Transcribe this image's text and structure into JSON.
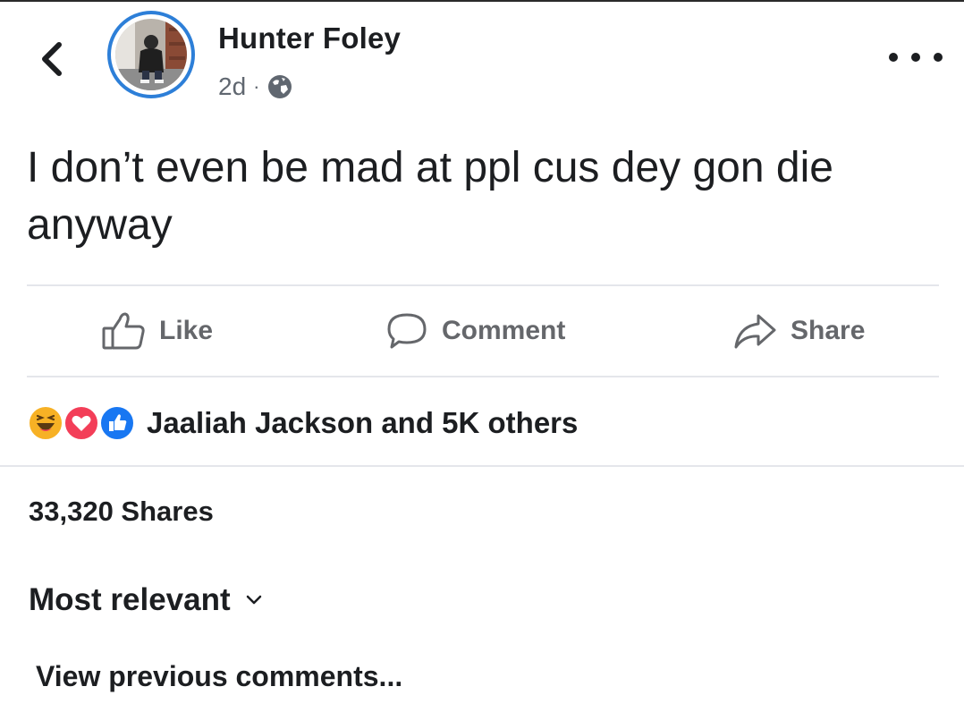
{
  "post": {
    "author": "Hunter Foley",
    "age": "2d",
    "separator": "·",
    "privacy_icon": "globe-icon",
    "text": "I don’t even be mad at ppl cus dey gon die anyway"
  },
  "actions": {
    "like_label": "Like",
    "comment_label": "Comment",
    "share_label": "Share"
  },
  "reactions": {
    "icons": [
      "haha-icon",
      "love-icon",
      "like-icon"
    ],
    "summary": "Jaaliah Jackson and 5K others"
  },
  "shares": {
    "count_label": "33,320 Shares"
  },
  "comments": {
    "sort_label": "Most relevant",
    "view_previous": "View previous comments..."
  },
  "colors": {
    "avatar_ring": "#2d7fd8",
    "love": "#f33e58",
    "like": "#1877f2",
    "haha": "#f7b125"
  }
}
